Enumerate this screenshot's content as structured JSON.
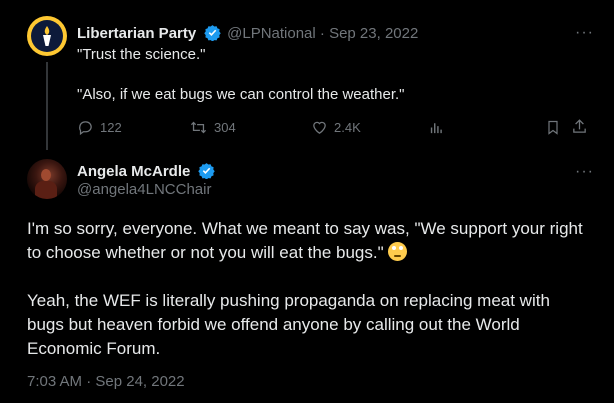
{
  "quoted_tweet": {
    "author_name": "Libertarian Party",
    "handle_date": "@LPNational · Sep 23, 2022",
    "line1": "\"Trust the science.\"",
    "line2": "\"Also, if we eat bugs we can control the weather.\"",
    "replies": "122",
    "retweets": "304",
    "likes": "2.4K",
    "avatar_icon": "torch-logo-icon"
  },
  "main_tweet": {
    "author_name": "Angela McArdle",
    "handle": "@angela4LNCChair",
    "para1": "I'm so sorry, everyone. What we meant to say was, \"We support your right to choose whether or not you will eat the bugs.\"",
    "emoji_icon": "eye-roll-emoji",
    "para2": "Yeah, the WEF is literally pushing propaganda on replacing meat with bugs but heaven forbid we offend anyone by calling out the World Economic Forum.",
    "timestamp": "7:03 AM · Sep 24, 2022"
  },
  "more_label": "···",
  "colors": {
    "verified": "#1d9bf0",
    "lp_gold": "#fec832",
    "muted": "#71767b"
  }
}
